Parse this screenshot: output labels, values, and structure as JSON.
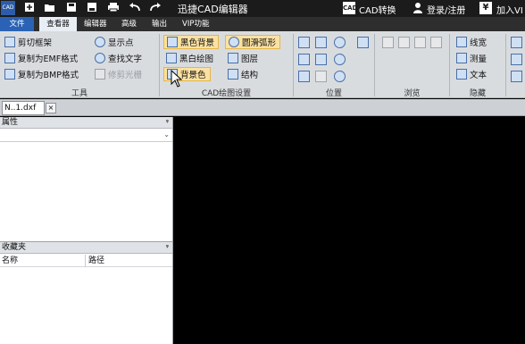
{
  "app": {
    "title": "迅捷CAD编辑器",
    "logo_text": "CAD",
    "quick_access": [
      "new-icon",
      "open-icon",
      "save-icon",
      "save-as-icon",
      "print-icon",
      "undo-icon",
      "redo-icon"
    ]
  },
  "titlebar_right": {
    "cad_convert": "CAD转换",
    "login": "登录/注册",
    "join": "加入VI"
  },
  "menu": {
    "file": "文件",
    "tabs": [
      "查看器",
      "编辑器",
      "高级",
      "输出",
      "VIP功能"
    ]
  },
  "ribbon": {
    "tools": {
      "label": "工具",
      "items": [
        "剪切框架",
        "复制为EMF格式",
        "复制为BMP格式",
        "显示点",
        "查找文字",
        "修剪光栅"
      ]
    },
    "cad_settings": {
      "label": "CAD绘图设置",
      "items": [
        "黑色背景",
        "黑白绘图",
        "背景色",
        "圆滑弧形",
        "图层",
        "结构"
      ]
    },
    "position": {
      "label": "位置"
    },
    "browse": {
      "label": "浏览"
    },
    "hide": {
      "label": "隐藏",
      "items": [
        "线宽",
        "测量",
        "文本"
      ]
    }
  },
  "document": {
    "tab_name": "N..1.dxf",
    "close_glyph": "×"
  },
  "properties_panel": {
    "title": "属性",
    "pin": "ᵠ",
    "dropdown_arrow": "⌄"
  },
  "favorites_panel": {
    "title": "收藏夹",
    "pin": "ᵠ",
    "columns": [
      "名称",
      "路径"
    ]
  },
  "colors": {
    "accent": "#2a63b5",
    "highlight": "#fbe1a2",
    "canvas": "#000000"
  }
}
